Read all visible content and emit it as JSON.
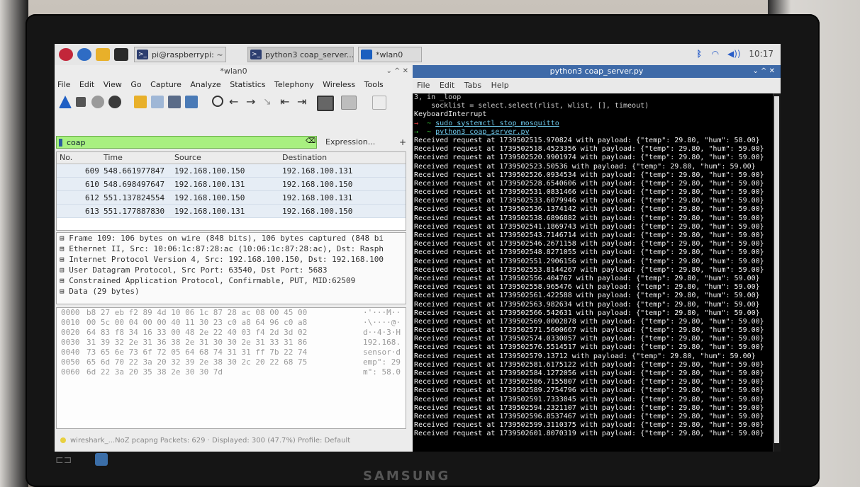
{
  "taskbar": {
    "tasks": [
      {
        "label": "pi@raspberrypi: ~"
      },
      {
        "label": "python3 coap_server..."
      },
      {
        "label": "*wlan0"
      }
    ],
    "clock": "10:17"
  },
  "wireshark": {
    "title": "*wlan0",
    "menu": [
      "File",
      "Edit",
      "View",
      "Go",
      "Capture",
      "Analyze",
      "Statistics",
      "Telephony",
      "Wireless",
      "Tools"
    ],
    "filter_value": "coap",
    "expression_label": "Expression...",
    "columns": [
      "No.",
      "Time",
      "Source",
      "Destination"
    ],
    "packets": [
      {
        "no": "609",
        "time": "548.661977847",
        "src": "192.168.100.150",
        "dst": "192.168.100.131"
      },
      {
        "no": "610",
        "time": "548.698497647",
        "src": "192.168.100.131",
        "dst": "192.168.100.150"
      },
      {
        "no": "612",
        "time": "551.137824554",
        "src": "192.168.100.150",
        "dst": "192.168.100.131"
      },
      {
        "no": "613",
        "time": "551.177887830",
        "src": "192.168.100.131",
        "dst": "192.168.100.150"
      }
    ],
    "details": [
      "Frame 109: 106 bytes on wire (848 bits), 106 bytes captured (848 bi",
      "Ethernet II, Src: 10:06:1c:87:28:ac (10:06:1c:87:28:ac), Dst: Rasph",
      "Internet Protocol Version 4, Src: 192.168.100.150, Dst: 192.168.100",
      "User Datagram Protocol, Src Port: 63540, Dst Port: 5683",
      "Constrained Application Protocol, Confirmable, PUT, MID:62509",
      "Data (29 bytes)"
    ],
    "hex": [
      {
        "off": "0000",
        "bytes": "b8 27 eb f2 89 4d 10 06  1c 87 28 ac 08 00 45 00",
        "ascii": "·'···M·· ··(···E·"
      },
      {
        "off": "0010",
        "bytes": "00 5c 00 04 00 00 40 11  30 23 c0 a8 64 96 c0 a8",
        "ascii": "·\\····@· 0#··d···"
      },
      {
        "off": "0020",
        "bytes": "64 83 f8 34 16 33 00 48  2e 22 40 03 f4 2d 3d 02",
        "ascii": "d··4·3·H .\"@··-=·"
      },
      {
        "off": "0030",
        "bytes": "31 39 32 2e 31 36 38 2e  31 30 30 2e 31 33 31 86",
        "ascii": "192.168. 100.131·"
      },
      {
        "off": "0040",
        "bytes": "73 65 6e 73 6f 72 05 64  68 74 31 31 ff 7b 22 74",
        "ascii": "sensor·d ht11·{\"t"
      },
      {
        "off": "0050",
        "bytes": "65 6d 70 22 3a 20 32 39  2e 38 30 2c 20 22 68 75",
        "ascii": "emp\": 29 .80, \"hu"
      },
      {
        "off": "0060",
        "bytes": "6d 22 3a 20 35 38 2e 30  30 7d",
        "ascii": "m\": 58.0 0}"
      }
    ],
    "status": "wireshark_...NoZ pcapng   Packets: 629 · Displayed: 300 (47.7%)   Profile: Default"
  },
  "terminal": {
    "title": "python3 coap_server.py",
    "menu": [
      "File",
      "Edit",
      "Tabs",
      "Help"
    ],
    "head": [
      "3, in _loop",
      "    socklist = select.select(rlist, wlist, [], timeout)",
      "KeyboardInterrupt"
    ],
    "cmd1": "sudo systemctl stop mosquitto",
    "cmd2": "python3 coap_server.py",
    "requests": [
      {
        "ts": "1739502515.970824",
        "hum": "58.00"
      },
      {
        "ts": "1739502518.4523356",
        "hum": "59.00"
      },
      {
        "ts": "1739502520.9901974",
        "hum": "59.00"
      },
      {
        "ts": "1739502523.50536",
        "hum": "59.00"
      },
      {
        "ts": "1739502526.0934534",
        "hum": "59.00"
      },
      {
        "ts": "1739502528.6540606",
        "hum": "59.00"
      },
      {
        "ts": "1739502531.0831466",
        "hum": "59.00"
      },
      {
        "ts": "1739502533.6079946",
        "hum": "59.00"
      },
      {
        "ts": "1739502536.1374142",
        "hum": "59.00"
      },
      {
        "ts": "1739502538.6896882",
        "hum": "59.00"
      },
      {
        "ts": "1739502541.1869743",
        "hum": "59.00"
      },
      {
        "ts": "1739502543.7146714",
        "hum": "59.00"
      },
      {
        "ts": "1739502546.2671158",
        "hum": "59.00"
      },
      {
        "ts": "1739502548.8271055",
        "hum": "59.00"
      },
      {
        "ts": "1739502551.2906156",
        "hum": "59.00"
      },
      {
        "ts": "1739502553.8144267",
        "hum": "59.00"
      },
      {
        "ts": "1739502556.404767",
        "hum": "59.00"
      },
      {
        "ts": "1739502558.965476",
        "hum": "59.00"
      },
      {
        "ts": "1739502561.422588",
        "hum": "59.00"
      },
      {
        "ts": "1739502563.982634",
        "hum": "59.00"
      },
      {
        "ts": "1739502566.542631",
        "hum": "59.00"
      },
      {
        "ts": "1739502569.0002878",
        "hum": "59.00"
      },
      {
        "ts": "1739502571.5600667",
        "hum": "59.00"
      },
      {
        "ts": "1739502574.0330057",
        "hum": "59.00"
      },
      {
        "ts": "1739502576.5514517",
        "hum": "59.00"
      },
      {
        "ts": "1739502579.13712",
        "hum": "59.00"
      },
      {
        "ts": "1739502581.6175122",
        "hum": "59.00"
      },
      {
        "ts": "1739502584.1272056",
        "hum": "59.00"
      },
      {
        "ts": "1739502586.7155807",
        "hum": "59.00"
      },
      {
        "ts": "1739502589.2754796",
        "hum": "59.00"
      },
      {
        "ts": "1739502591.7333045",
        "hum": "59.00"
      },
      {
        "ts": "1739502594.2321107",
        "hum": "59.00"
      },
      {
        "ts": "1739502596.8537467",
        "hum": "59.00"
      },
      {
        "ts": "1739502599.3110375",
        "hum": "59.00"
      },
      {
        "ts": "1739502601.8070319",
        "hum": "59.00"
      }
    ],
    "temp": "29.80"
  },
  "monitor": {
    "brand": "SAMSUNG"
  }
}
